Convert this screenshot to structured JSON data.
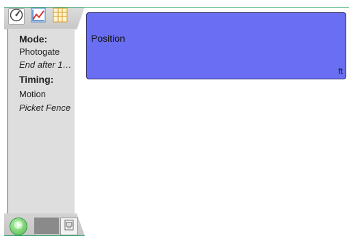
{
  "tabs": [
    {
      "name": "meter",
      "icon": "meter-icon"
    },
    {
      "name": "graph",
      "icon": "graph-icon"
    },
    {
      "name": "table",
      "icon": "table-icon"
    }
  ],
  "sidebar": {
    "mode_heading": "Mode:",
    "mode_value": "Photogate",
    "mode_end": "End after 1…",
    "timing_heading": "Timing:",
    "timing_value": "Motion",
    "timing_sub": "Picket Fence"
  },
  "meter": {
    "label": "Position",
    "unit": "ft",
    "color": "#6a6ef2"
  },
  "bottom": {
    "start_icon": "play-icon",
    "file_icon": "file-icon"
  }
}
